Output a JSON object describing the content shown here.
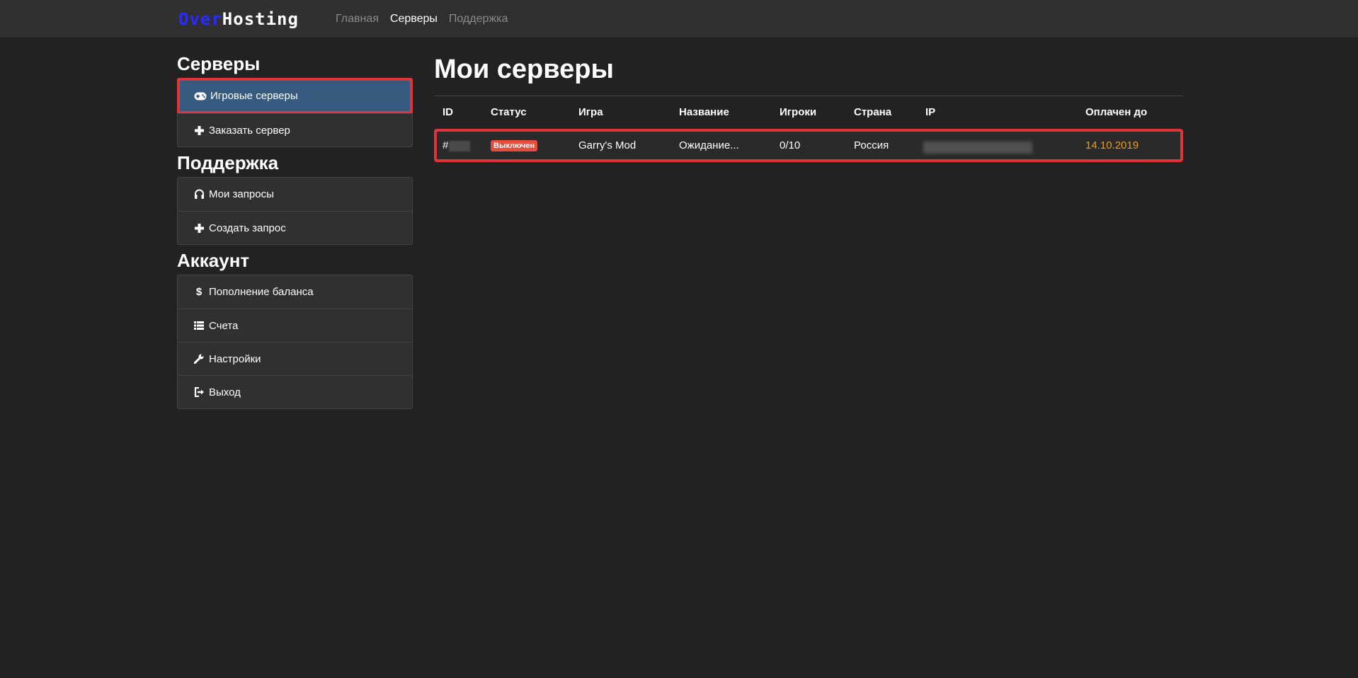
{
  "navbar": {
    "brand_part1": "Over",
    "brand_part2": "Hosting",
    "links": [
      {
        "label": "Главная",
        "active": false
      },
      {
        "label": "Серверы",
        "active": true
      },
      {
        "label": "Поддержка",
        "active": false
      }
    ]
  },
  "sidebar": {
    "sections": [
      {
        "heading": "Серверы",
        "items": [
          {
            "label": "Игровые серверы",
            "icon": "gamepad-icon",
            "active": true
          },
          {
            "label": "Заказать сервер",
            "icon": "plus-icon",
            "active": false
          }
        ]
      },
      {
        "heading": "Поддержка",
        "items": [
          {
            "label": "Мои запросы",
            "icon": "headphones-icon",
            "active": false
          },
          {
            "label": "Создать запрос",
            "icon": "plus-icon",
            "active": false
          }
        ]
      },
      {
        "heading": "Аккаунт",
        "items": [
          {
            "label": "Пополнение баланса",
            "icon": "dollar-icon",
            "active": false
          },
          {
            "label": "Счета",
            "icon": "list-icon",
            "active": false
          },
          {
            "label": "Настройки",
            "icon": "wrench-icon",
            "active": false
          },
          {
            "label": "Выход",
            "icon": "logout-icon",
            "active": false
          }
        ]
      }
    ]
  },
  "main": {
    "title": "Мои серверы",
    "table": {
      "headers": [
        "ID",
        "Статус",
        "Игра",
        "Название",
        "Игроки",
        "Страна",
        "IP",
        "Оплачен до"
      ],
      "rows": [
        {
          "id_prefix": "#",
          "status": "Выключен",
          "game": "Garry's Mod",
          "name": "Ожидание...",
          "players": "0/10",
          "country": "Россия",
          "paid_until": "14.10.2019"
        }
      ]
    }
  },
  "colors": {
    "background": "#222222",
    "navbar": "#303030",
    "accent_blue": "#375a7f",
    "highlight_red": "#e0343b",
    "status_off": "#e74c3c",
    "paid_orange": "#f39c12",
    "brand_blue": "#2b2bff"
  }
}
